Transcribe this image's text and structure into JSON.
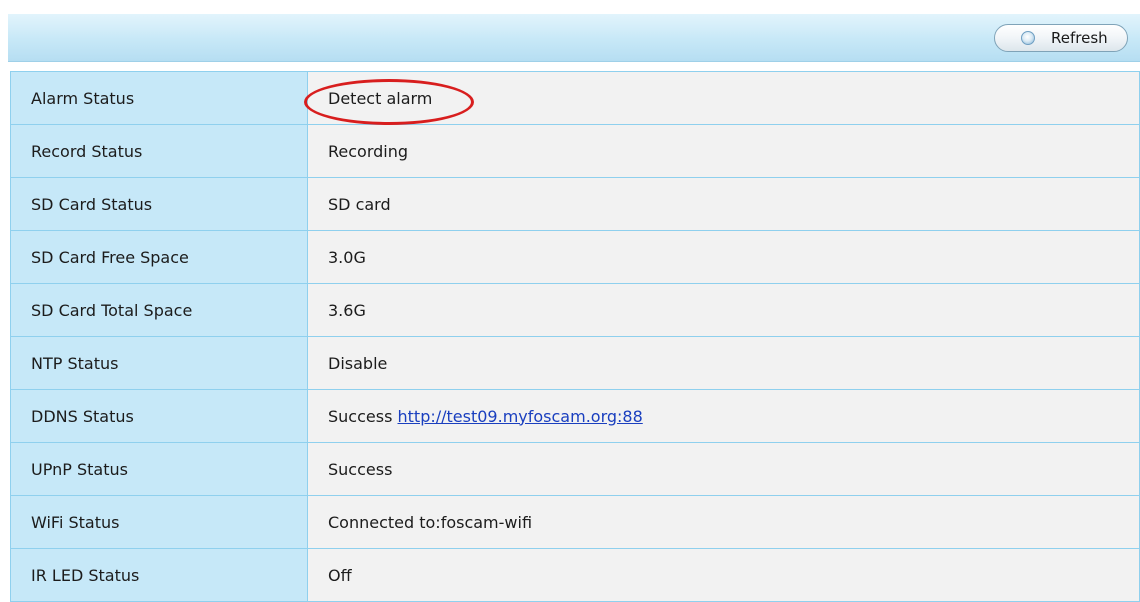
{
  "toolbar": {
    "refresh_label": "Refresh",
    "refresh_icon": "refresh-icon"
  },
  "rows": [
    {
      "label": "Alarm Status",
      "value": "Detect alarm"
    },
    {
      "label": "Record Status",
      "value": "Recording"
    },
    {
      "label": "SD Card Status",
      "value": "SD card"
    },
    {
      "label": "SD Card Free Space",
      "value": "3.0G"
    },
    {
      "label": "SD Card Total Space",
      "value": "3.6G"
    },
    {
      "label": "NTP Status",
      "value": "Disable"
    },
    {
      "label": "DDNS Status",
      "value": "Success",
      "link": "http://test09.myfoscam.org:88"
    },
    {
      "label": "UPnP Status",
      "value": "Success"
    },
    {
      "label": "WiFi Status",
      "value": "Connected to:foscam-wifi"
    },
    {
      "label": "IR LED Status",
      "value": "Off"
    }
  ],
  "colors": {
    "label_bg": "#c6e8f8",
    "value_bg": "#f2f2f2",
    "grid": "#8fd0ee",
    "link": "#1a3fbf",
    "highlight": "#d81e1e"
  }
}
